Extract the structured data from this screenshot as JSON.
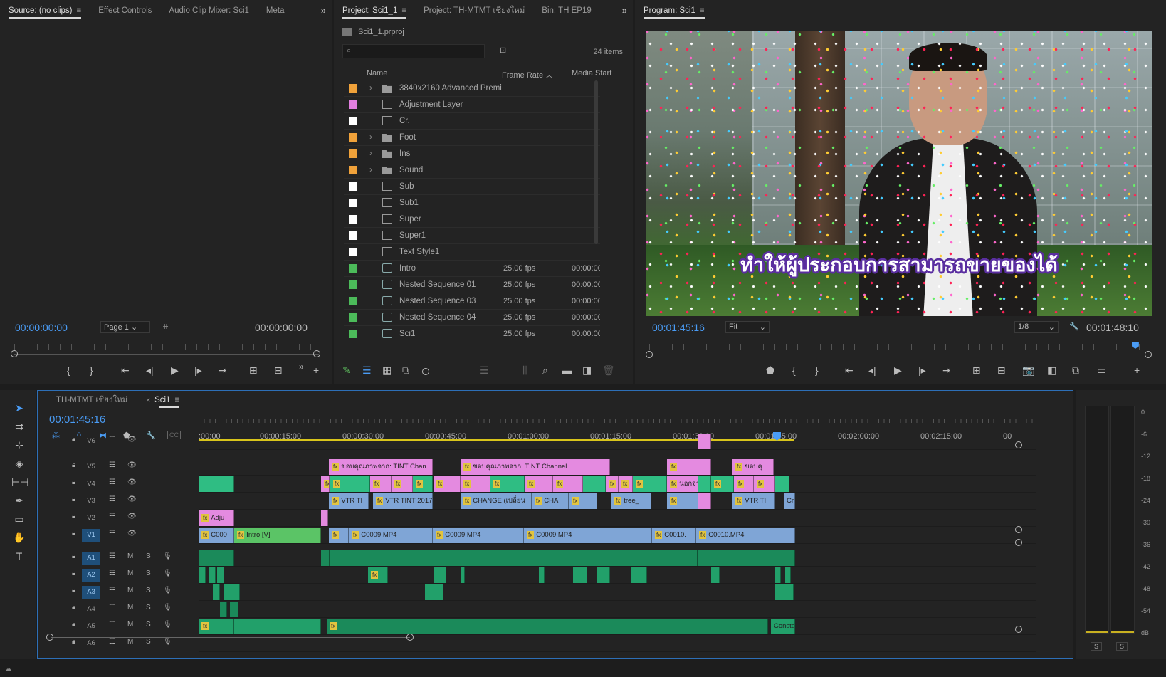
{
  "source": {
    "tabs": [
      "Source: (no clips)",
      "Effect Controls",
      "Audio Clip Mixer: Sci1",
      "Meta"
    ],
    "timecode_in": "00:00:00:00",
    "timecode_out": "00:00:00:00",
    "page": "Page 1"
  },
  "project": {
    "tabs": [
      "Project: Sci1_1",
      "Project: TH-MTMT เชียงใหม่",
      "Bin: TH EP19"
    ],
    "file": "Sci1_1.prproj",
    "search_placeholder": "",
    "items_count": "24 items",
    "columns": {
      "name": "Name",
      "frame_rate": "Frame Rate",
      "media_start": "Media Start"
    },
    "rows": [
      {
        "name": "3840x2160 Advanced Premi",
        "color": "#f0a23a",
        "icon": "folder-icon",
        "expand": true,
        "fr": "",
        "ms": ""
      },
      {
        "name": "Adjustment Layer",
        "color": "#e27fe0",
        "icon": "adjustment-icon",
        "expand": false,
        "fr": "",
        "ms": ""
      },
      {
        "name": "Cr.",
        "color": "#ffffff",
        "icon": "title-icon",
        "expand": false,
        "fr": "",
        "ms": ""
      },
      {
        "name": "Foot",
        "color": "#f0a23a",
        "icon": "folder-icon",
        "expand": true,
        "fr": "",
        "ms": ""
      },
      {
        "name": "Ins",
        "color": "#f0a23a",
        "icon": "folder-icon",
        "expand": true,
        "fr": "",
        "ms": ""
      },
      {
        "name": "Sound",
        "color": "#f0a23a",
        "icon": "folder-icon",
        "expand": true,
        "fr": "",
        "ms": ""
      },
      {
        "name": "Sub",
        "color": "#ffffff",
        "icon": "title-icon",
        "expand": false,
        "fr": "",
        "ms": ""
      },
      {
        "name": "Sub1",
        "color": "#ffffff",
        "icon": "title-icon",
        "expand": false,
        "fr": "",
        "ms": ""
      },
      {
        "name": "Super",
        "color": "#ffffff",
        "icon": "title-icon",
        "expand": false,
        "fr": "",
        "ms": ""
      },
      {
        "name": "Super1",
        "color": "#ffffff",
        "icon": "title-icon",
        "expand": false,
        "fr": "",
        "ms": ""
      },
      {
        "name": "Text Style1",
        "color": "#ffffff",
        "icon": "title-icon",
        "expand": false,
        "fr": "",
        "ms": ""
      },
      {
        "name": "Intro",
        "color": "#4cbb5a",
        "icon": "sequence-icon",
        "expand": false,
        "fr": "25.00 fps",
        "ms": "00:00:00:"
      },
      {
        "name": "Nested Sequence 01",
        "color": "#4cbb5a",
        "icon": "sequence-icon",
        "expand": false,
        "fr": "25.00 fps",
        "ms": "00:00:00:"
      },
      {
        "name": "Nested Sequence 03",
        "color": "#4cbb5a",
        "icon": "sequence-icon",
        "expand": false,
        "fr": "25.00 fps",
        "ms": "00:00:00:"
      },
      {
        "name": "Nested Sequence 04",
        "color": "#4cbb5a",
        "icon": "sequence-icon",
        "expand": false,
        "fr": "25.00 fps",
        "ms": "00:00:00:"
      },
      {
        "name": "Sci1",
        "color": "#4cbb5a",
        "icon": "sequence-icon",
        "expand": false,
        "fr": "25.00 fps",
        "ms": "00:00:00:"
      }
    ]
  },
  "program": {
    "tab": "Program: Sci1",
    "subtitle": "ทำให้ผู้ประกอบการสามารถขายของได้",
    "timecode": "00:01:45:16",
    "fit": "Fit",
    "resolution": "1/8",
    "duration": "00:01:48:10",
    "progress": 0.97
  },
  "timeline": {
    "tabs": [
      "TH-MTMT เชียงใหม่",
      "Sci1"
    ],
    "timecode": "00:01:45:16",
    "ruler": [
      ":00:00",
      "00:00:15:00",
      "00:00:30:00",
      "00:00:45:00",
      "00:01:00:00",
      "00:01:15:00",
      "00:01:30:00",
      "00:01:45:00",
      "00:02:00:00",
      "00:02:15:00",
      "00"
    ],
    "video_tracks": [
      "V6",
      "V5",
      "V4",
      "V3",
      "V2",
      "V1"
    ],
    "audio_tracks": [
      "A1",
      "A2",
      "A3",
      "A4",
      "A5",
      "A6"
    ],
    "toggle_m": "M",
    "toggle_s": "S",
    "clip_labels": {
      "v5a": "ขอบคุณภาพจาก: TINT Chan",
      "v5b": "ขอบคุณภาพจาก: TINT Channel",
      "v5c": "ขอบคุ",
      "v4a": "นอกจา",
      "v3a": "VTR TI",
      "v3b": "VTR TINT 2017",
      "v3c": "CHANGE (เปลี่ยน",
      "v3d": "CHA",
      "v3e": "tree_",
      "v3f": "VTR TI",
      "v3g": "Cr",
      "v2a": "Adju",
      "v1a": "C000",
      "v1b": "Intro [V]",
      "v1c": "C0009.MP4",
      "v1d": "C0009.MP4",
      "v1e": "C0009.MP4",
      "v1f": "C0010.",
      "v1g": "C0010.MP4",
      "a5a": "Constan",
      "fx": "fx"
    }
  },
  "meter": {
    "scale": [
      "0",
      "-6",
      "-12",
      "-18",
      "-24",
      "-30",
      "-36",
      "-42",
      "-48",
      "-54",
      "dB"
    ],
    "solo": [
      "S",
      "S"
    ]
  }
}
